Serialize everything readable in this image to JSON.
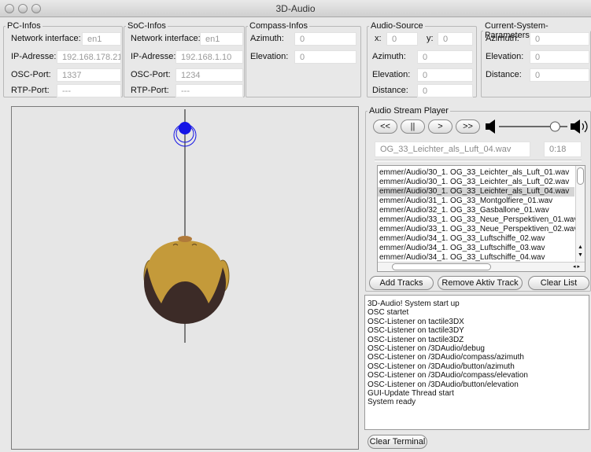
{
  "window": {
    "title": "3D-Audio"
  },
  "pc_infos": {
    "legend": "PC-Infos",
    "network_label": "Network interface:",
    "network_value": "en1",
    "ip_label": "IP-Adresse:",
    "ip_value": "192.168.178.21",
    "osc_label": "OSC-Port:",
    "osc_value": "1337",
    "rtp_label": "RTP-Port:",
    "rtp_value": "---"
  },
  "soc_infos": {
    "legend": "SoC-Infos",
    "network_label": "Network interface:",
    "network_value": "en1",
    "ip_label": "IP-Adresse:",
    "ip_value": "192.168.1.10",
    "osc_label": "OSC-Port:",
    "osc_value": "1234",
    "rtp_label": "RTP-Port:",
    "rtp_value": "---"
  },
  "compass_infos": {
    "legend": "Compass-Infos",
    "azimuth_label": "Azimuth:",
    "azimuth_value": "0",
    "elevation_label": "Elevation:",
    "elevation_value": "0"
  },
  "audio_source": {
    "legend": "Audio-Source",
    "x_label": "x:",
    "x_value": "0",
    "y_label": "y:",
    "y_value": "0",
    "azimuth_label": "Azimuth:",
    "azimuth_value": "0",
    "elevation_label": "Elevation:",
    "elevation_value": "0",
    "distance_label": "Distance:",
    "distance_value": "0"
  },
  "current_system": {
    "legend": "Current-System-Parameters",
    "azimuth_label": "Azimuth:",
    "azimuth_value": "0",
    "elevation_label": "Elevation:",
    "elevation_value": "0",
    "distance_label": "Distance:",
    "distance_value": "0"
  },
  "player": {
    "legend": "Audio Stream Player",
    "rewind_label": "<<",
    "pause_label": "||",
    "play_label": ">",
    "forward_label": ">>",
    "volume_level": 0.82,
    "current_track": "OG_33_Leichter_als_Luft_04.wav",
    "time": "0:18",
    "progress": 0.0,
    "tracks": [
      "emmer/Audio/30_1. OG_33_Leichter_als_Luft_01.wav",
      "emmer/Audio/30_1. OG_33_Leichter_als_Luft_02.wav",
      "emmer/Audio/30_1. OG_33_Leichter_als_Luft_04.wav",
      "emmer/Audio/31_1. OG_33_Montgolfiere_01.wav",
      "emmer/Audio/32_1. OG_33_Gasballone_01.wav",
      "emmer/Audio/33_1. OG_33_Neue_Perspektiven_01.wav",
      "emmer/Audio/33_1. OG_33_Neue_Perspektiven_02.wav",
      "emmer/Audio/34_1. OG_33_Luftschiffe_02.wav",
      "emmer/Audio/34_1. OG_33_Luftschiffe_03.wav",
      "emmer/Audio/34_1. OG_33_Luftschiffe_04.wav"
    ],
    "selected_index": 2,
    "add_tracks_label": "Add Tracks",
    "remove_label": "Remove Aktiv Track",
    "clear_list_label": "Clear List"
  },
  "terminal": {
    "lines": [
      "3D-Audio! System start up",
      "OSC startet",
      "OSC-Listener on tactile3DX",
      "OSC-Listener on tactile3DY",
      "OSC-Listener on tactile3DZ",
      "OSC-Listener on /3DAudio/debug",
      "OSC-Listener on /3DAudio/compass/azimuth",
      "OSC-Listener on /3DAudio/button/azimuth",
      "OSC-Listener on /3DAudio/compass/elevation",
      "OSC-Listener on /3DAudio/button/elevation",
      "GUI-Update Thread start",
      "System ready"
    ],
    "clear_label": "Clear Terminal"
  },
  "colors": {
    "source_dot": "#1515e6",
    "head_gold": "#c49a3a",
    "head_dark": "#3c2b27",
    "ear": "#c49a3a"
  }
}
